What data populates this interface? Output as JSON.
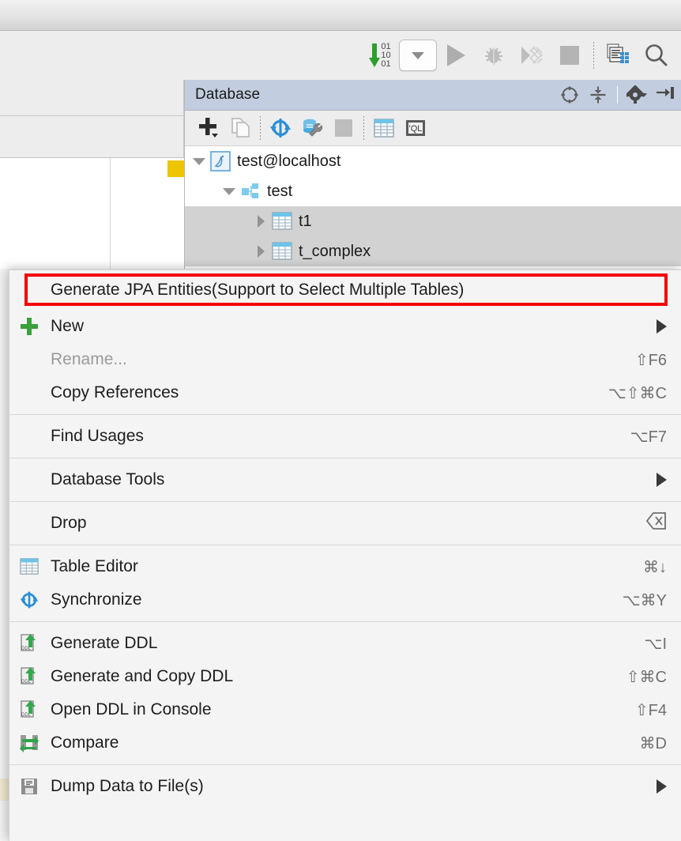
{
  "ide": {
    "toolbar": {
      "binary_rows": [
        "01",
        "10",
        "01"
      ],
      "buttons": [
        {
          "name": "update-running-application-icon",
          "label": "Update Running Application"
        },
        {
          "name": "run-configuration-combo",
          "label": "Run Configuration"
        },
        {
          "name": "run-icon",
          "label": "Run"
        },
        {
          "name": "debug-icon",
          "label": "Debug"
        },
        {
          "name": "run-with-coverage-icon",
          "label": "Run with Coverage"
        },
        {
          "name": "stop-icon",
          "label": "Stop"
        },
        {
          "name": "database-inspector-icon",
          "label": "Database"
        },
        {
          "name": "search-icon",
          "label": "Search Everywhere"
        }
      ]
    }
  },
  "database_panel": {
    "title": "Database",
    "header_buttons": [
      {
        "name": "scroll-from-source-icon",
        "label": "Scroll from Source"
      },
      {
        "name": "collapse-all-icon",
        "label": "Collapse All"
      },
      {
        "name": "settings-gear-icon",
        "label": "Settings"
      },
      {
        "name": "hide-panel-icon",
        "label": "Hide"
      }
    ],
    "toolbar_buttons": [
      {
        "name": "add-new-icon",
        "label": "New"
      },
      {
        "name": "duplicate-icon",
        "label": "Duplicate"
      },
      {
        "name": "synchronize-icon",
        "label": "Synchronize"
      },
      {
        "name": "data-source-properties-icon",
        "label": "Data Source Properties"
      },
      {
        "name": "stop-icon",
        "label": "Stop"
      },
      {
        "name": "table-editor-icon",
        "label": "Table Editor"
      },
      {
        "name": "query-console-icon",
        "label": "Open Query Console"
      }
    ],
    "tree": [
      {
        "label": "test@localhost",
        "icon": "mysql-datasource-icon",
        "expanded": true,
        "indent": 0,
        "selected": false
      },
      {
        "label": "test",
        "icon": "schema-icon",
        "expanded": true,
        "indent": 1,
        "selected": false
      },
      {
        "label": "t1",
        "icon": "table-icon",
        "expanded": false,
        "indent": 2,
        "selected": true
      },
      {
        "label": "t_complex",
        "icon": "table-icon",
        "expanded": false,
        "indent": 2,
        "selected": true
      }
    ]
  },
  "context_menu": {
    "highlight_color": "#f40000",
    "groups": [
      {
        "items": [
          {
            "label": "Generate JPA Entities(Support to Select Multiple Tables)",
            "icon": null,
            "shortcut": "",
            "submenu": false,
            "disabled": false,
            "highlighted": true,
            "name": "menu-item-generate-jpa-entities"
          },
          {
            "label": "New",
            "icon": "plus-green-icon",
            "shortcut": "",
            "submenu": true,
            "disabled": false,
            "highlighted": false,
            "name": "menu-item-new"
          },
          {
            "label": "Rename...",
            "icon": null,
            "shortcut": "⇧F6",
            "submenu": false,
            "disabled": true,
            "highlighted": false,
            "name": "menu-item-rename"
          },
          {
            "label": "Copy References",
            "icon": null,
            "shortcut": "⌥⇧⌘C",
            "submenu": false,
            "disabled": false,
            "highlighted": false,
            "name": "menu-item-copy-references"
          }
        ]
      },
      {
        "items": [
          {
            "label": "Find Usages",
            "icon": null,
            "shortcut": "⌥F7",
            "submenu": false,
            "disabled": false,
            "highlighted": false,
            "name": "menu-item-find-usages"
          }
        ]
      },
      {
        "items": [
          {
            "label": "Database Tools",
            "icon": null,
            "shortcut": "",
            "submenu": true,
            "disabled": false,
            "highlighted": false,
            "name": "menu-item-database-tools"
          }
        ]
      },
      {
        "items": [
          {
            "label": "Drop",
            "icon": null,
            "shortcut": "⌧",
            "submenu": false,
            "disabled": false,
            "highlighted": false,
            "name": "menu-item-drop"
          }
        ]
      },
      {
        "items": [
          {
            "label": "Table Editor",
            "icon": "table-editor-icon",
            "shortcut": "⌘↓",
            "submenu": false,
            "disabled": false,
            "highlighted": false,
            "name": "menu-item-table-editor"
          },
          {
            "label": "Synchronize",
            "icon": "synchronize-icon",
            "shortcut": "⌥⌘Y",
            "submenu": false,
            "disabled": false,
            "highlighted": false,
            "name": "menu-item-synchronize"
          }
        ]
      },
      {
        "items": [
          {
            "label": "Generate DDL",
            "icon": "ddl-icon",
            "shortcut": "⌥I",
            "submenu": false,
            "disabled": false,
            "highlighted": false,
            "name": "menu-item-generate-ddl"
          },
          {
            "label": "Generate and Copy DDL",
            "icon": "ddl-icon",
            "shortcut": "⇧⌘C",
            "submenu": false,
            "disabled": false,
            "highlighted": false,
            "name": "menu-item-generate-and-copy-ddl"
          },
          {
            "label": "Open DDL in Console",
            "icon": "ddl-icon",
            "shortcut": "⇧F4",
            "submenu": false,
            "disabled": false,
            "highlighted": false,
            "name": "menu-item-open-ddl-in-console"
          },
          {
            "label": "Compare",
            "icon": "compare-icon",
            "shortcut": "⌘D",
            "submenu": false,
            "disabled": false,
            "highlighted": false,
            "name": "menu-item-compare"
          }
        ]
      },
      {
        "items": [
          {
            "label": "Dump Data to File(s)",
            "icon": "dump-data-icon",
            "shortcut": "",
            "submenu": true,
            "disabled": false,
            "highlighted": false,
            "name": "menu-item-dump-data-to-files"
          }
        ]
      }
    ]
  }
}
